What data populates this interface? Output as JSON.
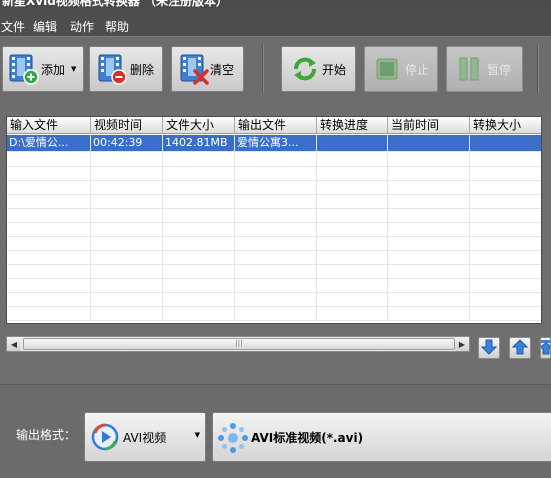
{
  "window": {
    "title": "新星Xvid视频格式转换器 （未注册版本）"
  },
  "menu": [
    "文件",
    "编辑",
    "动作",
    "帮助"
  ],
  "toolbar": {
    "add": "添加",
    "delete": "删除",
    "clear": "清空",
    "start": "开始",
    "stop": "停止",
    "pause": "暂停"
  },
  "table": {
    "columns": [
      "输入文件",
      "视频时间",
      "文件大小",
      "输出文件",
      "转换进度",
      "当前时间",
      "转换大小"
    ],
    "rows": [
      {
        "input": "D:\\爱情公...",
        "duration": "00:42:39",
        "size": "1402.81MB",
        "output": "爱情公寓3...",
        "progress": "",
        "current": "",
        "converted": ""
      }
    ]
  },
  "output": {
    "label": "输出格式：",
    "format": "AVI视频",
    "preset": "AVI标准视频(*.avi)"
  },
  "colors": {
    "selection": "#3a6fc9",
    "toolbar_bg": "#6c6c6c",
    "menubar_bg": "#4e4e4e"
  }
}
